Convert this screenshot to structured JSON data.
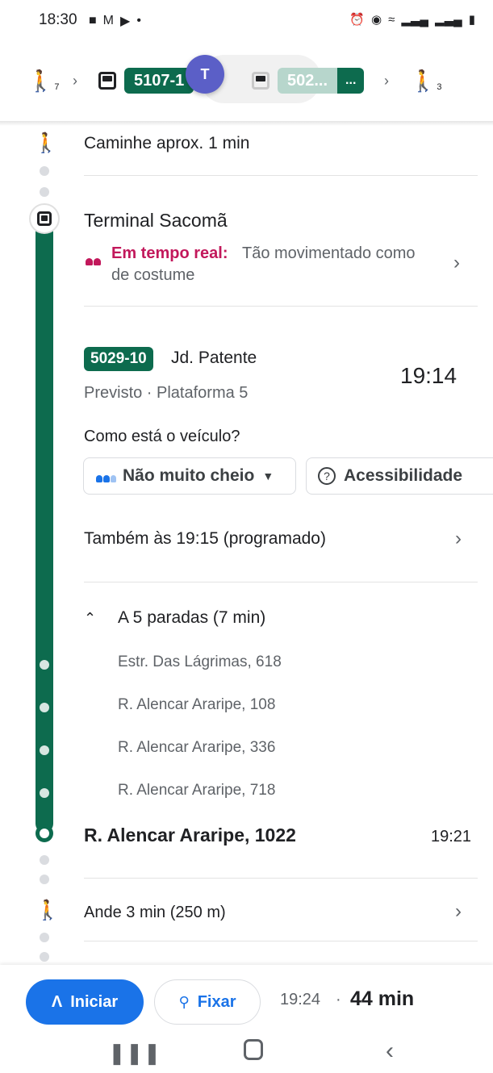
{
  "status_bar": {
    "time": "18:30",
    "left_icons": [
      "chat-icon",
      "gmail-icon",
      "youtube-icon",
      "dot-icon"
    ],
    "right_icons": [
      "alarm-icon",
      "location-icon",
      "wifi-icon",
      "signal-icon",
      "signal-icon",
      "battery-icon"
    ]
  },
  "route_strip": {
    "walk_start_minutes": "7",
    "bus1_label": "5107-1",
    "bus2_label": "502...",
    "bus2_tail": "...",
    "walk_end_minutes": "3",
    "teams_label": "T"
  },
  "steps": {
    "walk_first": "Caminhe aprox. 1 min",
    "terminal_name": "Terminal Sacomã",
    "realtime_label": "Em tempo real:",
    "realtime_text_line1": "Tão movimentado como",
    "realtime_text_line2": "de costume",
    "route_badge": "5029-10",
    "route_destination": "Jd. Patente",
    "departure_time": "19:14",
    "forecast": "Previsto · Plataforma 5",
    "vehicle_question": "Como está o veículo?",
    "crowd_chip": "Não muito cheio",
    "accessibility_chip": "Acessibilidade",
    "also_at": "Também às 19:15 (programado)",
    "stops_summary": "A 5 paradas (7 min)",
    "intermediate_stops": [
      "Estr. Das Lágrimas, 618",
      "R. Alencar Araripe, 108",
      "R. Alencar Araripe, 336",
      "R. Alencar Araripe, 718"
    ],
    "arrival_stop": "R. Alencar Araripe, 1022",
    "arrival_time": "19:21",
    "walk_last": "Ande 3 min (250 m)"
  },
  "bottom": {
    "start_label": "Iniciar",
    "pin_label": "Fixar",
    "eta_time": "19:24",
    "separator": "·",
    "duration": "44 min"
  },
  "colors": {
    "transit_green": "#0d6b4e",
    "accent_blue": "#1a73e8",
    "realtime_magenta": "#c2185b"
  }
}
